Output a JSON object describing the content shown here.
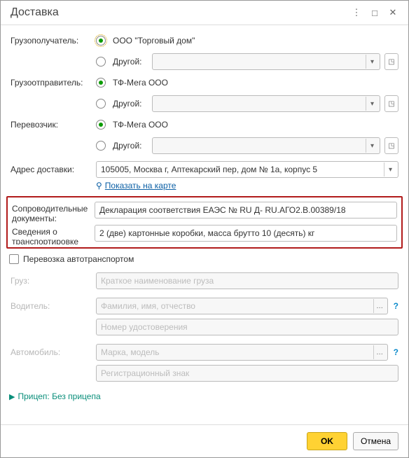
{
  "window": {
    "title": "Доставка"
  },
  "consignee": {
    "label": "Грузополучатель:",
    "main": "ООО \"Торговый дом\"",
    "other_label": "Другой:",
    "other_value": ""
  },
  "consignor": {
    "label": "Грузоотправитель:",
    "main": "ТФ-Мега ООО",
    "other_label": "Другой:",
    "other_value": ""
  },
  "carrier": {
    "label": "Перевозчик:",
    "main": "ТФ-Мега ООО",
    "other_label": "Другой:",
    "other_value": ""
  },
  "delivery_address": {
    "label": "Адрес доставки:",
    "value": "105005, Москва г, Аптекарский пер, дом № 1а, корпус 5",
    "map_link": "Показать на карте"
  },
  "accompanying_docs": {
    "label": "Сопроводительные документы:",
    "value": "Декларация соответствия ЕАЭС № RU Д- RU.АГО2.В.00389/18"
  },
  "transport_info": {
    "label": "Сведения о транспортировке (для УПД):",
    "value": "2 (две) картонные коробки, масса брутто 10 (десять) кг"
  },
  "truck_checkbox": {
    "label": "Перевозка автотранспортом"
  },
  "cargo": {
    "label": "Груз:",
    "placeholder": "Краткое наименование груза"
  },
  "driver": {
    "label": "Водитель:",
    "name_placeholder": "Фамилия, имя, отчество",
    "id_placeholder": "Номер удостоверения"
  },
  "vehicle": {
    "label": "Автомобиль:",
    "model_placeholder": "Марка, модель",
    "reg_placeholder": "Регистрационный знак"
  },
  "trailer": {
    "label": "Прицеп:",
    "value": "Без прицепа"
  },
  "buttons": {
    "ok": "OK",
    "cancel": "Отмена"
  }
}
